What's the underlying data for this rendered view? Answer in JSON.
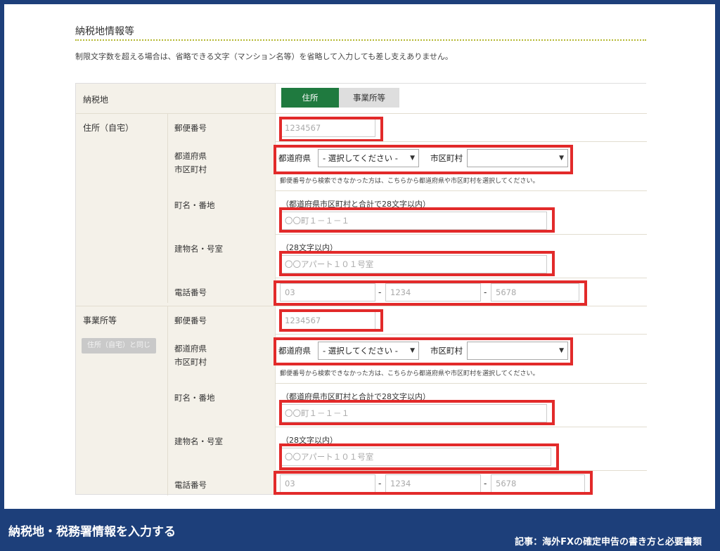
{
  "section": {
    "title": "納税地情報等",
    "note": "制限文字数を超える場合は、省略できる文字（マンション名等）を省略して入力しても差し支えありません。"
  },
  "nouzeichi": {
    "label": "納税地",
    "tabs": [
      {
        "label": "住所",
        "active": true
      },
      {
        "label": "事業所等",
        "active": false
      }
    ]
  },
  "home": {
    "label": "住所（自宅）",
    "postal": {
      "label": "郵便番号",
      "placeholder": "1234567"
    },
    "pref": {
      "label_line1": "都道府県",
      "label_line2": "市区町村",
      "pref_inline": "都道府県",
      "pref_select": "- 選択してください -",
      "city_inline": "市区町村",
      "city_select": "",
      "note": "郵便番号から検索できなかった方は、こちらから都道府県や市区町村を選択してください。"
    },
    "street": {
      "label": "町名・番地",
      "hint": "（都道府県市区町村と合計で28文字以内）",
      "placeholder": "〇〇町１－１－１"
    },
    "building": {
      "label": "建物名・号室",
      "hint": "（28文字以内）",
      "placeholder": "〇〇アパート１０１号室"
    },
    "phone": {
      "label": "電話番号",
      "part1": "03",
      "part2": "1234",
      "part3": "5678",
      "sep": "-"
    }
  },
  "office": {
    "label": "事業所等",
    "same_button": "住所（自宅）と同じ",
    "postal": {
      "label": "郵便番号",
      "placeholder": "1234567"
    },
    "pref": {
      "label_line1": "都道府県",
      "label_line2": "市区町村",
      "pref_inline": "都道府県",
      "pref_select": "- 選択してください -",
      "city_inline": "市区町村",
      "city_select": "",
      "note": "郵便番号から検索できなかった方は、こちらから都道府県や市区町村を選択してください。"
    },
    "street": {
      "label": "町名・番地",
      "hint": "（都道府県市区町村と合計で28文字以内）",
      "placeholder": "〇〇町１－１－１"
    },
    "building": {
      "label": "建物名・号室",
      "hint": "（28文字以内）",
      "placeholder": "〇〇アパート１０１号室"
    },
    "phone": {
      "label": "電話番号",
      "part1": "03",
      "part2": "1234",
      "part3": "5678",
      "sep": "-"
    }
  },
  "footer": {
    "caption": "納税地・税務署情報を入力する",
    "article": "記事：海外FXの確定申告の書き方と必要書類"
  },
  "colors": {
    "accent_green": "#1f7a3f",
    "highlight_red": "#e22a2a",
    "footer_navy": "#1d3f7a"
  }
}
